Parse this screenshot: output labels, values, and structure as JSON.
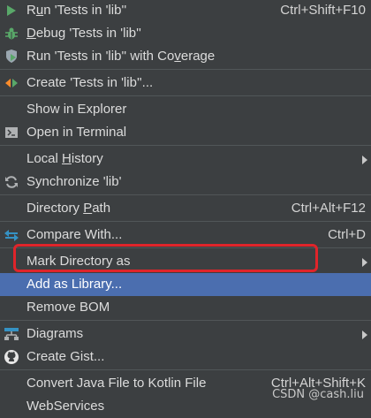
{
  "menu": {
    "run": {
      "pre": "R",
      "u": "u",
      "post": "n 'Tests in 'lib''",
      "shortcut": "Ctrl+Shift+F10"
    },
    "debug": {
      "pre": "",
      "u": "D",
      "post": "ebug 'Tests in 'lib''"
    },
    "coverage": {
      "pre": "Run 'Tests in 'lib'' with Co",
      "u": "v",
      "post": "erage"
    },
    "create": {
      "label": "Create 'Tests in 'lib''..."
    },
    "show_explorer": {
      "label": "Show in Explorer"
    },
    "open_terminal": {
      "label": "Open in Terminal"
    },
    "local_history": {
      "pre": "Local ",
      "u": "H",
      "post": "istory"
    },
    "synchronize": {
      "label": "Synchronize 'lib'"
    },
    "directory_path": {
      "pre": "Directory ",
      "u": "P",
      "post": "ath",
      "shortcut": "Ctrl+Alt+F12"
    },
    "compare_with": {
      "label": "Compare With...",
      "shortcut": "Ctrl+D"
    },
    "mark_directory": {
      "label": "Mark Directory as"
    },
    "add_library": {
      "label": "Add as Library..."
    },
    "remove_bom": {
      "label": "Remove BOM"
    },
    "diagrams": {
      "label": "Diagrams"
    },
    "create_gist": {
      "label": "Create Gist..."
    },
    "convert_kotlin": {
      "label": "Convert Java File to Kotlin File",
      "shortcut": "Ctrl+Alt+Shift+K"
    },
    "webservices": {
      "label": "WebServices"
    }
  },
  "watermark": "CSDN @cash.liu",
  "colors": {
    "background": "#3c3f41",
    "highlight": "#4b6eaf",
    "annotation_box": "#e0242a"
  }
}
